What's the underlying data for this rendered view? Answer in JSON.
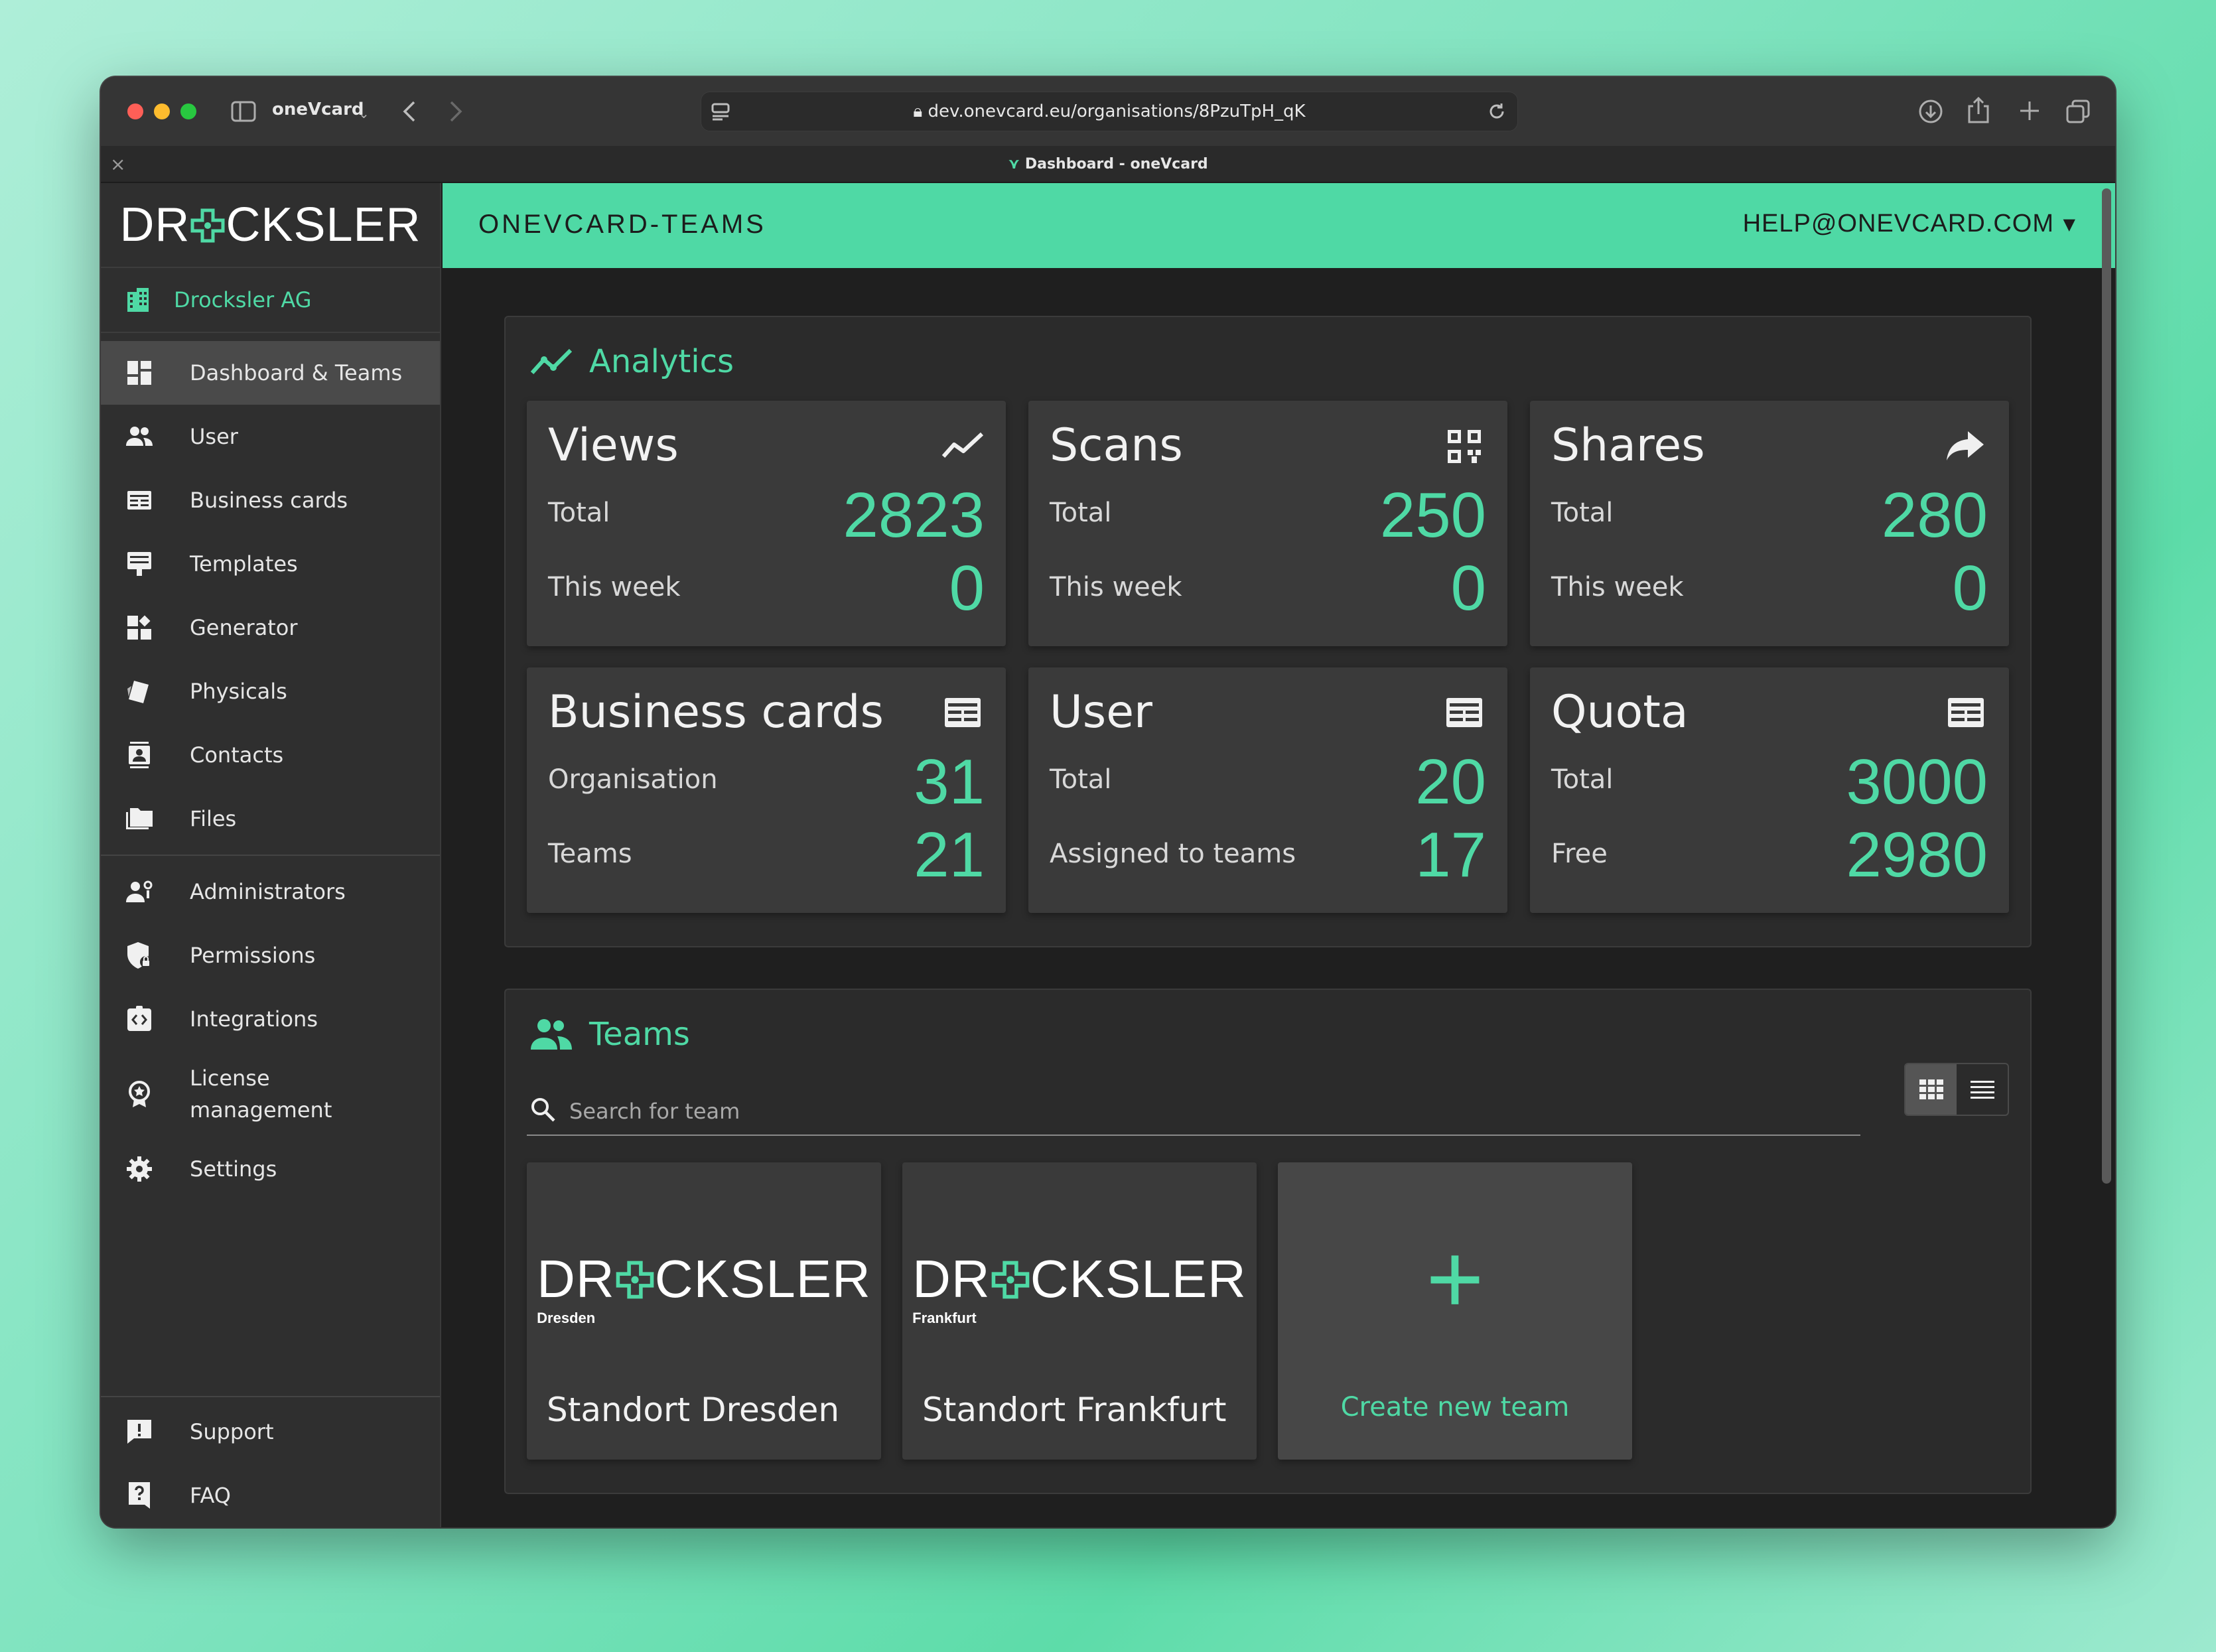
{
  "browser": {
    "tab_group": "oneVcard",
    "url": "dev.onevcard.eu/organisations/8PzuTpH_qK",
    "tab_title": "Dashboard - oneVcard"
  },
  "sidebar": {
    "brand": {
      "pre": "DR",
      "post": "CKSLER"
    },
    "organisation": "Drocksler AG",
    "items": [
      {
        "label": "Dashboard & Teams",
        "icon": "dashboard-icon"
      },
      {
        "label": "User",
        "icon": "users-icon"
      },
      {
        "label": "Business cards",
        "icon": "business-card-icon"
      },
      {
        "label": "Templates",
        "icon": "template-icon"
      },
      {
        "label": "Generator",
        "icon": "generator-icon"
      },
      {
        "label": "Physicals",
        "icon": "physical-card-icon"
      },
      {
        "label": "Contacts",
        "icon": "contacts-icon"
      },
      {
        "label": "Files",
        "icon": "folder-icon"
      }
    ],
    "admin_items": [
      {
        "label": "Administrators",
        "icon": "admin-icon"
      },
      {
        "label": "Permissions",
        "icon": "shield-lock-icon"
      },
      {
        "label": "Integrations",
        "icon": "integration-icon"
      },
      {
        "label": "License management",
        "icon": "license-badge-icon"
      },
      {
        "label": "Settings",
        "icon": "gear-icon"
      }
    ],
    "bottom_items": [
      {
        "label": "Support",
        "icon": "support-icon"
      },
      {
        "label": "FAQ",
        "icon": "faq-icon"
      }
    ]
  },
  "topbar": {
    "app_title": "ONEVCARD-TEAMS",
    "email": "HELP@ONEVCARD.COM"
  },
  "analytics": {
    "heading": "Analytics",
    "cards": [
      {
        "title": "Views",
        "icon": "trend-icon",
        "label1": "Total",
        "value1": "2823",
        "label2": "This week",
        "value2": "0"
      },
      {
        "title": "Scans",
        "icon": "qr-code-icon",
        "label1": "Total",
        "value1": "250",
        "label2": "This week",
        "value2": "0"
      },
      {
        "title": "Shares",
        "icon": "share-arrow-icon",
        "label1": "Total",
        "value1": "280",
        "label2": "This week",
        "value2": "0"
      },
      {
        "title": "Business cards",
        "icon": "card-icon",
        "label1": "Organisation",
        "value1": "31",
        "label2": "Teams",
        "value2": "21"
      },
      {
        "title": "User",
        "icon": "card-icon",
        "label1": "Total",
        "value1": "20",
        "label2": "Assigned to teams",
        "value2": "17"
      },
      {
        "title": "Quota",
        "icon": "card-icon",
        "label1": "Total",
        "value1": "3000",
        "label2": "Free",
        "value2": "2980"
      }
    ]
  },
  "teams": {
    "heading": "Teams",
    "search_placeholder": "Search for team",
    "items": [
      {
        "name": "Standort Dresden",
        "logo_sub": "Dresden"
      },
      {
        "name": "Standort Frankfurt",
        "logo_sub": "Frankfurt"
      }
    ],
    "create_label": "Create new team",
    "create_symbol": "+"
  },
  "colors": {
    "accent": "#4fd9a5",
    "sidebar": "#2f2f2f",
    "card": "#3a3a3a"
  }
}
